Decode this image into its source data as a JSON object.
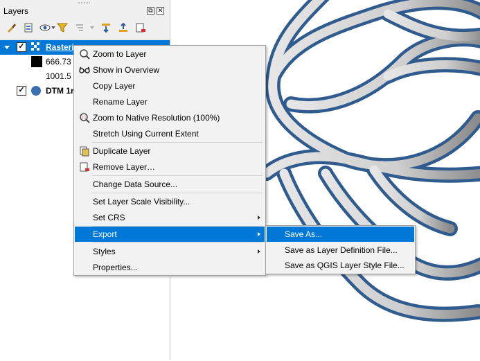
{
  "panel": {
    "title": "Layers",
    "float_glyph": "⧉",
    "close_glyph": "✕",
    "toolbar_icons": [
      "paintbrush-icon",
      "add-group-icon",
      "eye-icon",
      "filter-icon",
      "filter-legend-icon",
      "dropdown-icon",
      "expand-all-icon",
      "collapse-all-icon",
      "remove-layer-icon"
    ]
  },
  "tree": {
    "layer1": {
      "name": "Rasteri",
      "checked": "✓"
    },
    "legend_high": "666.73",
    "legend_low": "1001.5",
    "layer2": {
      "name": "DTM 1r",
      "checked": "✓"
    }
  },
  "context_menu": {
    "items": [
      {
        "label": "Zoom to Layer",
        "icon": "zoom-to-layer-icon"
      },
      {
        "label": "Show in Overview",
        "icon": "overview-glasses-icon"
      },
      {
        "label": "Copy Layer"
      },
      {
        "label": "Rename Layer"
      },
      {
        "label": "Zoom to Native Resolution (100%)",
        "icon": "zoom-native-icon"
      },
      {
        "label": "Stretch Using Current Extent"
      },
      {
        "label": "Duplicate Layer",
        "icon": "duplicate-layer-icon"
      },
      {
        "label": "Remove Layer…",
        "icon": "remove-layer-icon"
      },
      {
        "label": "Change Data Source..."
      },
      {
        "label": "Set Layer Scale Visibility..."
      },
      {
        "label": "Set CRS"
      },
      {
        "label": "Export"
      },
      {
        "label": "Styles"
      },
      {
        "label": "Properties..."
      }
    ]
  },
  "export_submenu": {
    "items": [
      {
        "label": "Save As..."
      },
      {
        "label": "Save as Layer Definition File..."
      },
      {
        "label": "Save as QGIS Layer Style File..."
      }
    ]
  },
  "colors": {
    "selection": "#0078d7",
    "road_casing": "#3c6496",
    "road_fill": "#d8d8d8"
  }
}
